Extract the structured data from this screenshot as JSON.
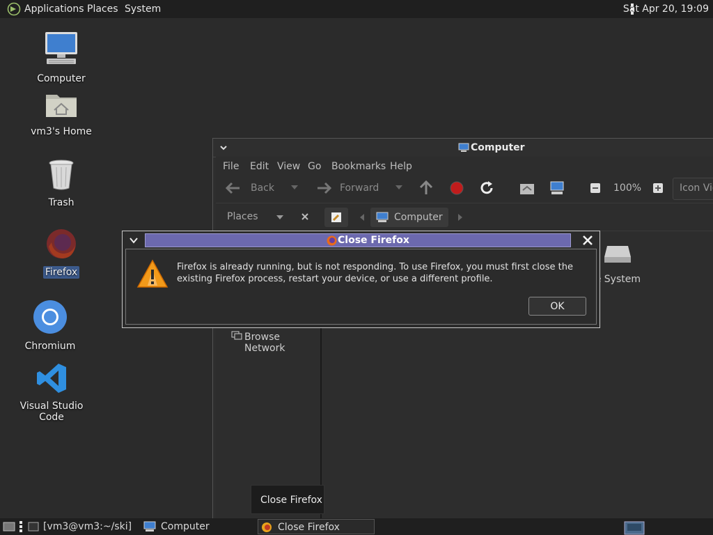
{
  "top_panel": {
    "menus": [
      "Applications",
      "Places",
      "System"
    ],
    "clock": "Sat Apr 20, 19:09"
  },
  "desktop_icons": [
    {
      "label": "Computer",
      "icon": "computer-icon"
    },
    {
      "label": "vm3's Home",
      "icon": "home-folder-icon"
    },
    {
      "label": "Trash",
      "icon": "trash-icon"
    },
    {
      "label": "Firefox",
      "icon": "firefox-icon"
    },
    {
      "label": "Chromium",
      "icon": "chromium-icon"
    },
    {
      "label": "Visual Studio Code",
      "icon": "vscode-icon"
    }
  ],
  "file_manager": {
    "title": "Computer",
    "menus": [
      "File",
      "Edit",
      "View",
      "Go",
      "Bookmarks",
      "Help"
    ],
    "toolbar": {
      "back": "Back",
      "forward": "Forward",
      "zoom": "100%",
      "view_mode": "Icon View"
    },
    "sidebar": {
      "title": "Places",
      "items": [
        "Browse Network"
      ]
    },
    "breadcrumb": "Computer",
    "content_items": [
      "File System"
    ]
  },
  "dialog": {
    "title": "Close Firefox",
    "message": "Firefox is already running, but is not responding. To use Firefox, you must first close the existing Firefox process, restart your device, or use a different profile.",
    "ok_label": "OK"
  },
  "tooltip": "Close Firefox",
  "taskbar": {
    "items": [
      "[vm3@vm3:~/ski]",
      "Computer",
      "Close Firefox"
    ]
  },
  "colors": {
    "dialog_titlebar": "#6c69ae",
    "panel": "#1f1f1f",
    "desktop": "#2b2b2b"
  }
}
